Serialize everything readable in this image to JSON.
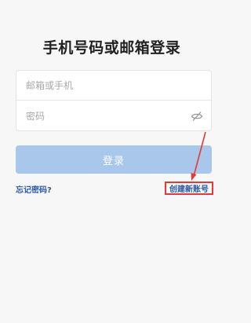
{
  "page": {
    "title": "手机号码或邮箱登录"
  },
  "form": {
    "account_placeholder": "邮箱或手机",
    "account_value": "",
    "password_placeholder": "密码",
    "password_value": "",
    "password_toggle_icon": "eye-off-icon"
  },
  "actions": {
    "login_label": "登录",
    "forgot_password_label": "忘记密码?",
    "create_account_label": "创建新账号"
  },
  "colors": {
    "primary_disabled": "#a9c7eb",
    "link": "#2b5aa8",
    "annotation": "#e53935"
  }
}
